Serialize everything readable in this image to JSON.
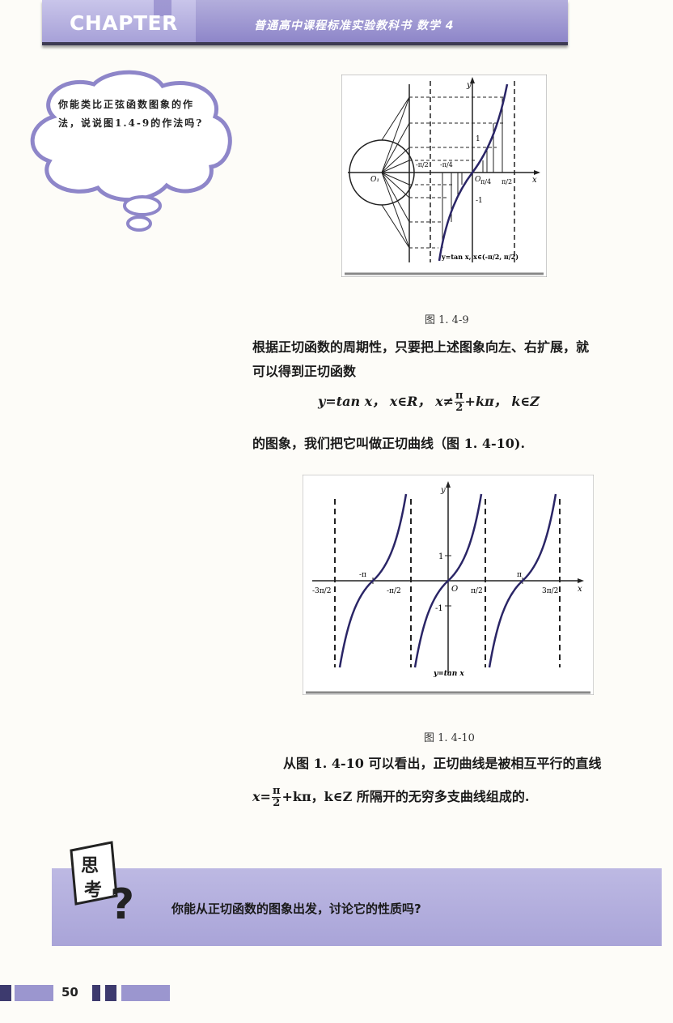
{
  "header": {
    "chapter_label": "CHAPTER",
    "book_title": "普通高中课程标准实验教科书  数学  4"
  },
  "cloud": {
    "text": "你能类比正弦函数图象的作法，说说图1.4-9的作法吗?"
  },
  "figure1": {
    "caption": "图 1. 4-9",
    "labels": {
      "y": "y",
      "x": "x",
      "one": "1",
      "minus_one": "-1",
      "origin": "O",
      "origin1": "O₁",
      "neg_pi_2": "-π/2",
      "neg_pi_4": "-π/4",
      "pi_4": "π/4",
      "pi_2": "π/2",
      "curve_label": "y=tan x, x∈(-π/2, π/2)"
    }
  },
  "para1": {
    "line1": "根据正切函数的周期性，只要把上述图象向左、右扩展，就",
    "line2": "可以得到正切函数"
  },
  "formula1": {
    "y_eq": "y=tan x，",
    "x_in_r": "x∈R，",
    "x_neq": "x≠",
    "frac_num": "π",
    "frac_den": "2",
    "plus_kpi": "+kπ，",
    "k_in_z": "k∈Z"
  },
  "para2": {
    "line": "的图象，我们把它叫做正切曲线（图 1. 4-10)."
  },
  "figure2": {
    "caption": "图 1. 4-10",
    "labels": {
      "y": "y",
      "x": "x",
      "one": "1",
      "minus_one": "-1",
      "origin": "O",
      "neg_3pi_2": "-3π/2",
      "neg_pi": "-π",
      "neg_pi_2": "-π/2",
      "pi_2": "π/2",
      "pi": "π",
      "three_pi_2": "3π/2",
      "curve_label": "y=tan x"
    }
  },
  "para3": {
    "line1": "从图 1. 4-10 可以看出，正切曲线是被相互平行的直线",
    "x_eq": "x=",
    "frac_num": "π",
    "frac_den": "2",
    "rest": "+kπ，k∈Z 所隔开的无穷多支曲线组成的."
  },
  "think": {
    "badge_text": "思考",
    "question": "你能从正切函数的图象出发，讨论它的性质吗?"
  },
  "footer": {
    "page_number": "50"
  },
  "colors": {
    "accent": "#8e86c9",
    "curve": "#2a2566"
  }
}
